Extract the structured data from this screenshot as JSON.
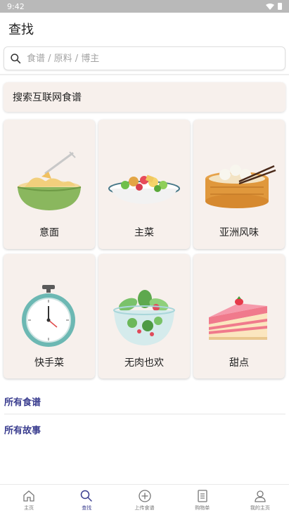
{
  "status_bar": {
    "time": "9:42"
  },
  "header": {
    "title": "查找"
  },
  "search": {
    "placeholder": "食谱 / 原料 / 博主"
  },
  "web_search": {
    "label": "搜索互联网食谱"
  },
  "categories": [
    {
      "label": "意面",
      "icon": "pasta-bowl-icon"
    },
    {
      "label": "主菜",
      "icon": "salad-plate-icon"
    },
    {
      "label": "亚洲风味",
      "icon": "dumpling-steamer-icon"
    },
    {
      "label": "快手菜",
      "icon": "stopwatch-icon"
    },
    {
      "label": "无肉也欢",
      "icon": "vegetable-bowl-icon"
    },
    {
      "label": "甜点",
      "icon": "cake-slice-icon"
    }
  ],
  "links": {
    "all_recipes": "所有食谱",
    "all_stories": "所有故事"
  },
  "nav": [
    {
      "label": "主页",
      "icon": "home-icon",
      "active": false
    },
    {
      "label": "查找",
      "icon": "search-icon",
      "active": true
    },
    {
      "label": "上传食谱",
      "icon": "add-circle-icon",
      "active": false
    },
    {
      "label": "购物单",
      "icon": "shopping-list-icon",
      "active": false
    },
    {
      "label": "我的主页",
      "icon": "profile-icon",
      "active": false
    }
  ],
  "colors": {
    "accent": "#3a3d8f",
    "card_bg": "#f7f0ec"
  }
}
